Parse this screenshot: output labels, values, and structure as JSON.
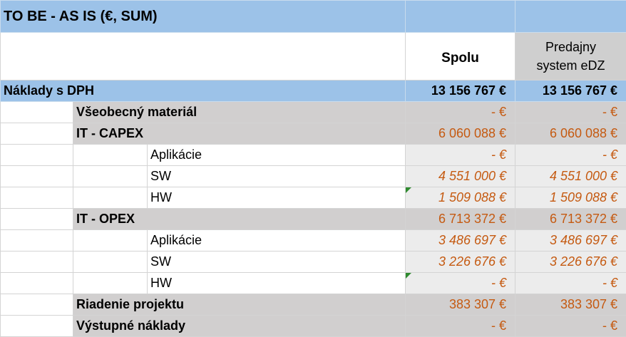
{
  "title": "TO BE - AS IS (€, SUM)",
  "headers": {
    "spolu": "Spolu",
    "predajny_line1": "Predajny",
    "predajny_line2": "system eDZ"
  },
  "rows": [
    {
      "label": "Náklady s DPH",
      "spolu": "13 156 767 €",
      "predajny": "13 156 767 €"
    },
    {
      "label": "Všeobecný materiál",
      "spolu": "- €",
      "predajny": "- €"
    },
    {
      "label": "IT - CAPEX",
      "spolu": "6 060 088 €",
      "predajny": "6 060 088 €"
    },
    {
      "label": "Aplikácie",
      "spolu": "- €",
      "predajny": "- €"
    },
    {
      "label": "SW",
      "spolu": "4 551 000 €",
      "predajny": "4 551 000 €"
    },
    {
      "label": "HW",
      "spolu": "1 509 088 €",
      "predajny": "1 509 088 €"
    },
    {
      "label": "IT - OPEX",
      "spolu": "6 713 372 €",
      "predajny": "6 713 372 €"
    },
    {
      "label": "Aplikácie",
      "spolu": "3 486 697 €",
      "predajny": "3 486 697 €"
    },
    {
      "label": "SW",
      "spolu": "3 226 676 €",
      "predajny": "3 226 676 €"
    },
    {
      "label": "HW",
      "spolu": "- €",
      "predajny": "- €"
    },
    {
      "label": "Riadenie projektu",
      "spolu": "383 307 €",
      "predajny": "383 307 €"
    },
    {
      "label": "Výstupné náklady",
      "spolu": "- €",
      "predajny": "- €"
    }
  ],
  "colors": {
    "header_blue": "#9cc2e8",
    "row_grey": "#d1cfcf",
    "value_orange": "#c55a11",
    "comment_marker": "#2f8a2f"
  }
}
